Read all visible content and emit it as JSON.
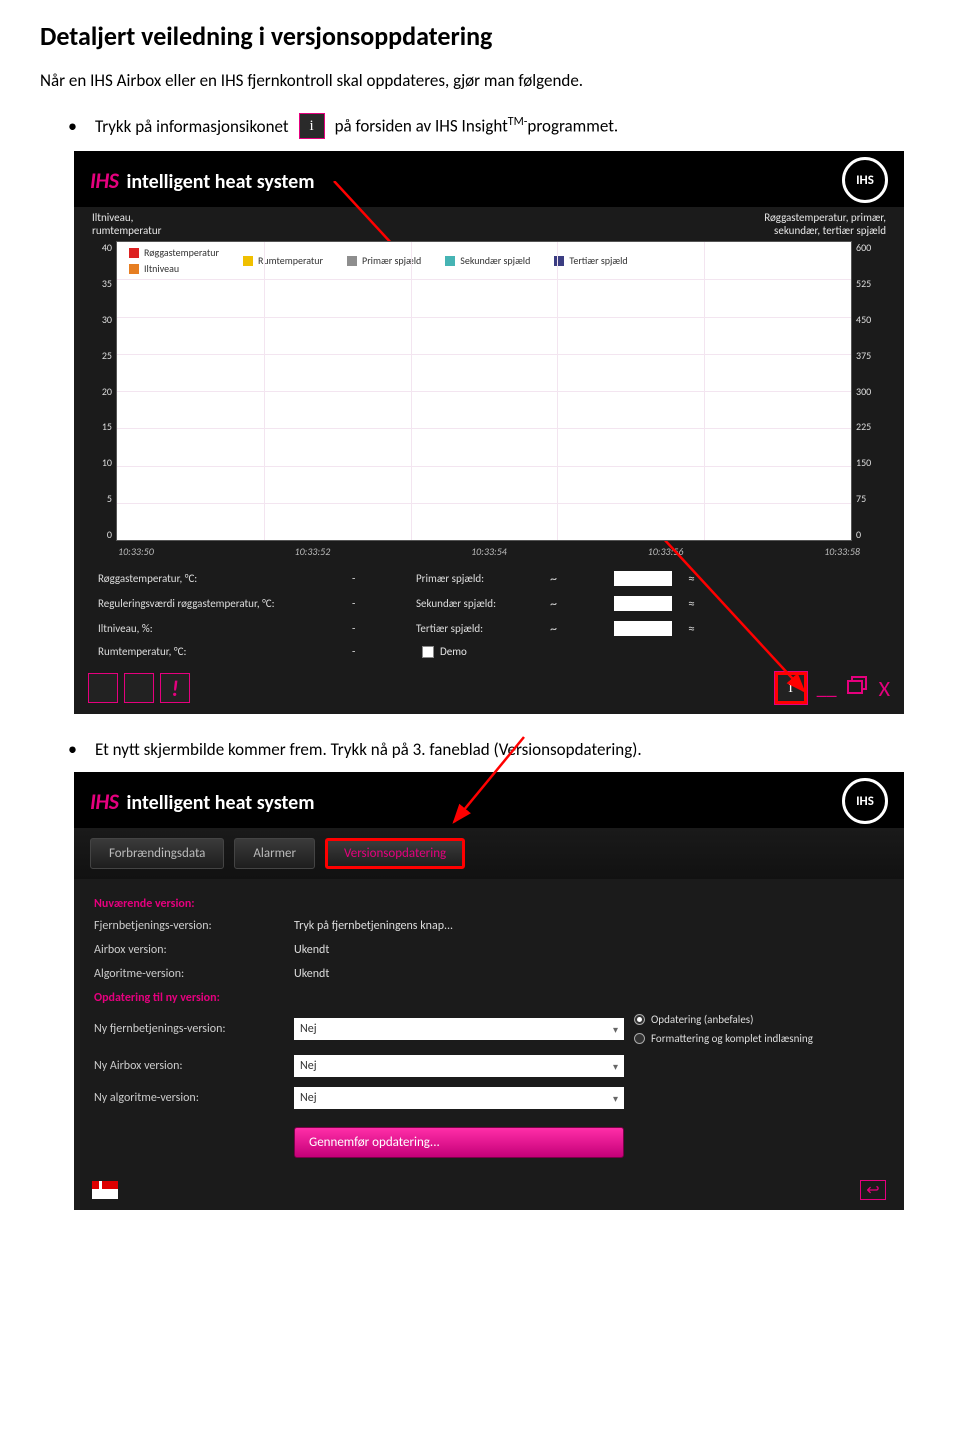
{
  "doc": {
    "title": "Detaljert veiledning i versjonsoppdatering",
    "intro": "Når en IHS Airbox eller en IHS fjernkontroll skal oppdateres, gjør man følgende.",
    "bullet1_before": "Trykk på informasjonsikonet",
    "bullet1_after_a": "på forsiden av IHS Insight",
    "bullet1_tm": "TM-",
    "bullet1_after_b": "programmet.",
    "bullet2": "Et nytt skjermbilde kommer frem. Trykk nå på 3. faneblad (Versionsopdatering)."
  },
  "app1": {
    "brand_ihs": "IHS",
    "brand_sub": "intelligent heat system",
    "logo": "IHS",
    "axis_left_title": "Iltniveau,\nrumtemperatur",
    "axis_right_title": "Røggastemperatur, primær,\nsekundær, tertiær spjæld",
    "legend": [
      {
        "c": "#d22",
        "t": "Røggastemperatur"
      },
      {
        "c": "#f0c000",
        "t": "Rumtemperatur"
      },
      {
        "c": "#8e8e8e",
        "t": "Primær spjæld"
      },
      {
        "c": "#46b4b4",
        "t": "Sekundær spjæld"
      },
      {
        "c": "#3b3d82",
        "t": "Tertiær spjæld"
      },
      {
        "c": "#e67e22",
        "t": "Iltniveau"
      }
    ],
    "left_ticks": [
      "40",
      "35",
      "30",
      "25",
      "20",
      "15",
      "10",
      "5",
      "0"
    ],
    "right_ticks": [
      "600",
      "525",
      "450",
      "375",
      "300",
      "225",
      "150",
      "75",
      "0"
    ],
    "x_ticks": [
      "10:33:50",
      "10:33:52",
      "10:33:54",
      "10:33:56",
      "10:33:58"
    ],
    "status": {
      "r1_l": "Røggastemperatur, °C:",
      "r1_v": "-",
      "r1_r": "Primær spjæld:",
      "r2_l": "Reguleringsværdi røggastemperatur, °C:",
      "r2_v": "-",
      "r2_r": "Sekundær spjæld:",
      "r3_l": "Iltniveau, %:",
      "r3_v": "-",
      "r3_r": "Tertiær spjæld:",
      "r4_l": "Rumtemperatur, °C:",
      "r4_v": "-",
      "demo": "Demo"
    },
    "info": "i",
    "excl": "!",
    "min": "__",
    "x": "X"
  },
  "app2": {
    "brand_ihs": "IHS",
    "brand_sub": "intelligent heat system",
    "logo": "IHS",
    "tabs": {
      "t1": "Forbrændingsdata",
      "t2": "Alarmer",
      "t3": "Versionsopdatering"
    },
    "sec1": "Nuværende version:",
    "rows1": [
      {
        "l": "Fjernbetjenings-version:",
        "v": "Tryk på fjernbetjeningens knap..."
      },
      {
        "l": "Airbox version:",
        "v": "Ukendt"
      },
      {
        "l": "Algoritme-version:",
        "v": "Ukendt"
      }
    ],
    "sec2": "Opdatering til ny version:",
    "rows2": [
      {
        "l": "Ny fjernbetjenings-version:",
        "v": "Nej"
      },
      {
        "l": "Ny Airbox version:",
        "v": "Nej"
      },
      {
        "l": "Ny algoritme-version:",
        "v": "Nej"
      }
    ],
    "radios": {
      "r1": "Opdatering (anbefales)",
      "r2": "Formattering og komplet indlæsning"
    },
    "submit": "Gennemfør opdatering..."
  },
  "chart_data": {
    "type": "line",
    "title": "",
    "x": [
      "10:33:50",
      "10:33:52",
      "10:33:54",
      "10:33:56",
      "10:33:58"
    ],
    "series": [
      {
        "name": "Røggastemperatur",
        "values": []
      },
      {
        "name": "Rumtemperatur",
        "values": []
      },
      {
        "name": "Primær spjæld",
        "values": []
      },
      {
        "name": "Sekundær spjæld",
        "values": []
      },
      {
        "name": "Tertiær spjæld",
        "values": []
      },
      {
        "name": "Iltniveau",
        "values": []
      }
    ],
    "y_left": {
      "label": "Iltniveau, rumtemperatur",
      "lim": [
        0,
        40
      ]
    },
    "y_right": {
      "label": "Røggastemperatur, primær, sekundær, tertiær spjæld",
      "lim": [
        0,
        600
      ]
    }
  }
}
